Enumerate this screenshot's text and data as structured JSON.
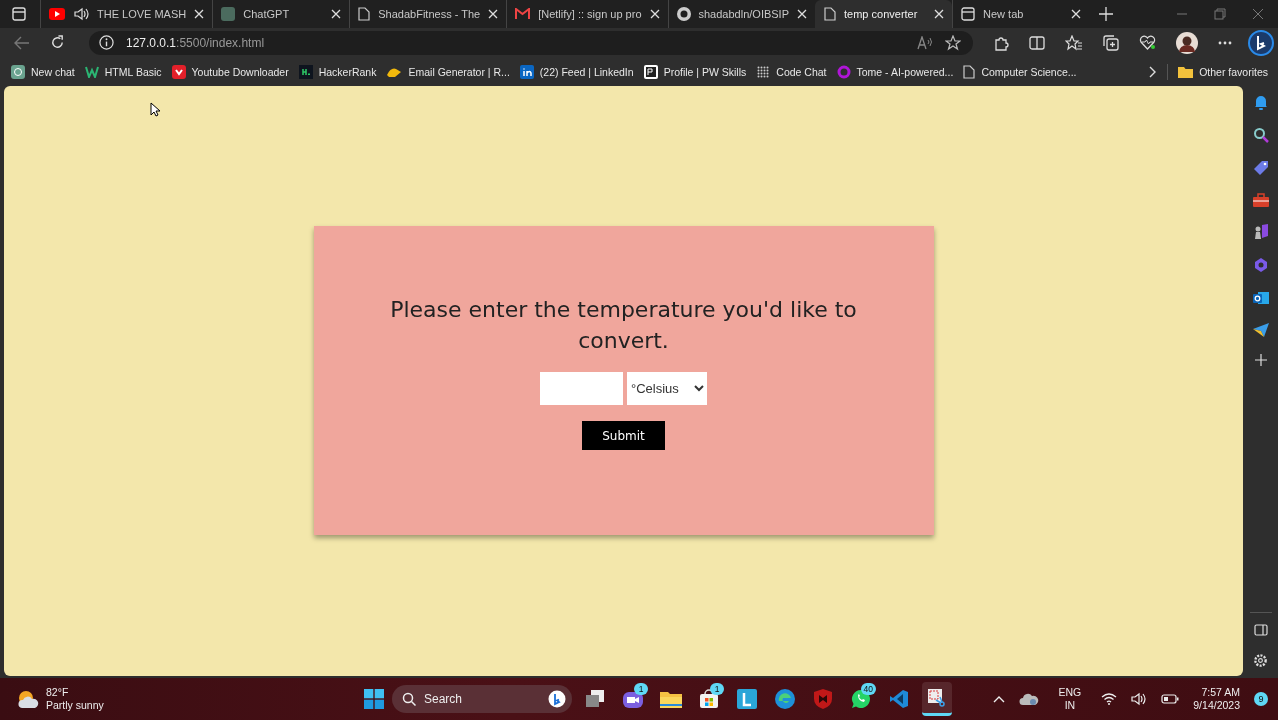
{
  "browser": {
    "tabs": [
      {
        "title": "THE LOVE MASH",
        "kind": "youtube",
        "audio": true,
        "selected": false
      },
      {
        "title": "ChatGPT",
        "kind": "chat",
        "audio": false,
        "selected": false
      },
      {
        "title": "ShadabFitness - The",
        "kind": "page",
        "audio": false,
        "selected": false
      },
      {
        "title": "[Netlify] :: sign up pro",
        "kind": "mail",
        "audio": false,
        "selected": false
      },
      {
        "title": "shadabdln/OIBSIP",
        "kind": "github",
        "audio": false,
        "selected": false
      },
      {
        "title": "temp converter",
        "kind": "page",
        "audio": false,
        "selected": true
      },
      {
        "title": "New tab",
        "kind": "newtab",
        "audio": false,
        "selected": false
      }
    ],
    "address": {
      "host": "127.0.0.1",
      "rest": ":5500/index.html"
    },
    "bookmarks": [
      {
        "label": "New chat",
        "kind": "chat"
      },
      {
        "label": "HTML Basic",
        "kind": "w"
      },
      {
        "label": "Youtube Downloader",
        "kind": "download"
      },
      {
        "label": "HackerRank",
        "kind": "hr"
      },
      {
        "label": "Email Generator | R...",
        "kind": "hand"
      },
      {
        "label": "(22) Feed | LinkedIn",
        "kind": "in"
      },
      {
        "label": "Profile | PW Skills",
        "kind": "pw"
      },
      {
        "label": "Code Chat",
        "kind": "dots"
      },
      {
        "label": "Tome - AI-powered...",
        "kind": "ring"
      },
      {
        "label": "Computer Science...",
        "kind": "page"
      }
    ],
    "other_favorites": "Other favorites"
  },
  "page": {
    "heading": "Please enter the temperature you'd like to convert.",
    "unit": "°Celsius",
    "submit": "Submit"
  },
  "taskbar": {
    "weather": {
      "temperature": "82°F",
      "condition": "Partly sunny"
    },
    "search": "Search",
    "apps": [
      {
        "kind": "taskview",
        "active": false
      },
      {
        "kind": "teams",
        "badge": "1",
        "active": false
      },
      {
        "kind": "folder",
        "active": false
      },
      {
        "kind": "store",
        "badge": "1",
        "active": false
      },
      {
        "kind": "l",
        "active": false
      },
      {
        "kind": "edge",
        "active": false
      },
      {
        "kind": "shield",
        "active": false
      },
      {
        "kind": "whatsapp",
        "badge": "40",
        "active": false
      },
      {
        "kind": "vscode",
        "active": false
      },
      {
        "kind": "snip",
        "active": true
      }
    ],
    "language": "ENG",
    "region": "IN",
    "time": "7:57 AM",
    "date": "9/14/2023",
    "notifications": "9"
  }
}
